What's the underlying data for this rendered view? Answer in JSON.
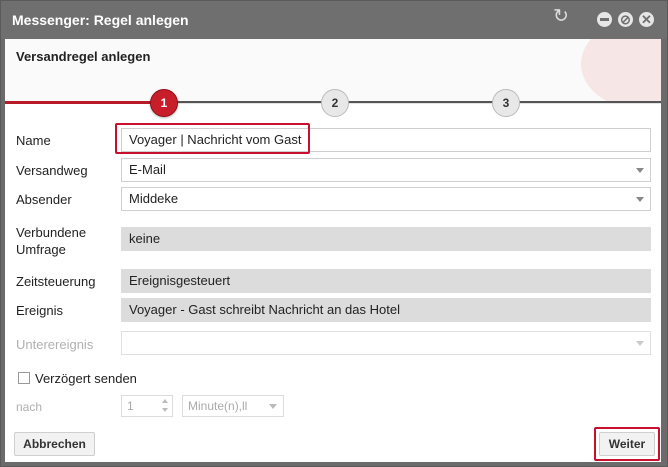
{
  "window": {
    "title": "Messenger: Regel anlegen"
  },
  "wizard": {
    "heading": "Versandregel anlegen",
    "steps": [
      "1",
      "2",
      "3"
    ],
    "active_step": 1
  },
  "form": {
    "name": {
      "label": "Name",
      "value": "Voyager | Nachricht vom Gast"
    },
    "versandweg": {
      "label": "Versandweg",
      "value": "E-Mail"
    },
    "absender": {
      "label": "Absender",
      "value": "Middeke"
    },
    "umfrage": {
      "label_line1": "Verbundene",
      "label_line2": "Umfrage",
      "value": "keine"
    },
    "zeitsteuerung": {
      "label": "Zeitsteuerung",
      "value": "Ereignisgesteuert"
    },
    "ereignis": {
      "label": "Ereignis",
      "value": "Voyager - Gast schreibt Nachricht an das Hotel"
    },
    "unterereignis": {
      "label": "Unterereignis",
      "value": ""
    },
    "verzoegert": {
      "label": "Verzögert senden",
      "checked": false
    },
    "nach": {
      "label": "nach",
      "amount": "1",
      "unit": "Minute(n),ll"
    }
  },
  "buttons": {
    "cancel": "Abbrechen",
    "next": "Weiter"
  },
  "colors": {
    "accent": "#c8102e",
    "titlebar": "#6f6f6f"
  }
}
